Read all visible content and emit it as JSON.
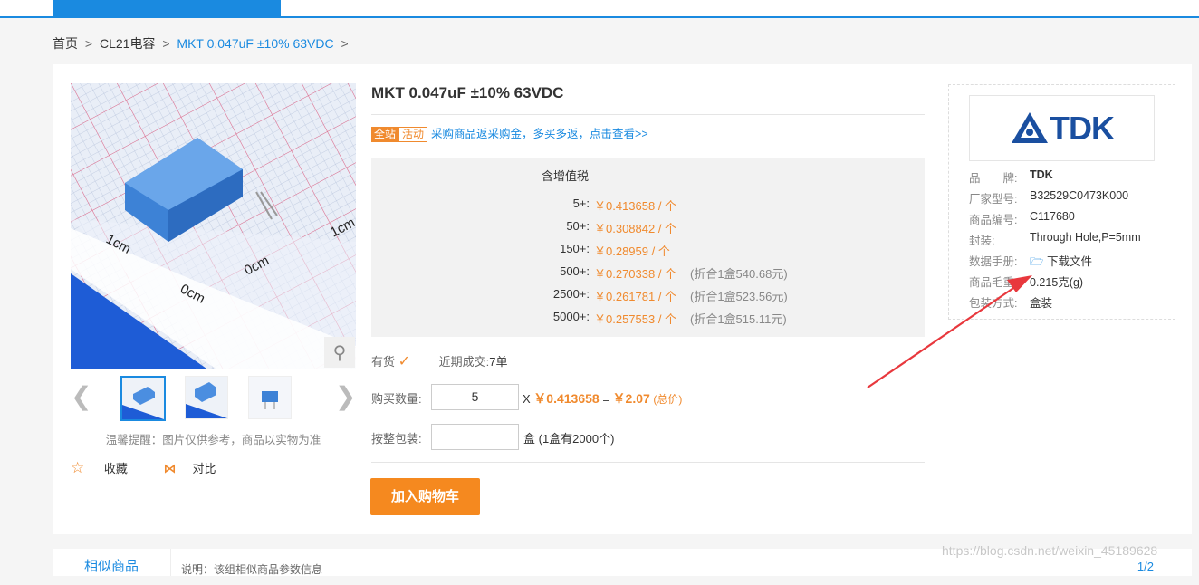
{
  "breadcrumb": {
    "home": "首页",
    "sep1": ">",
    "category": "CL21电容",
    "sep2": ">",
    "product": "MKT 0.047uF ±10% 63VDC",
    "trail": ">"
  },
  "product": {
    "title": "MKT 0.047uF ±10% 63VDC",
    "promo_badge_site": "全站",
    "promo_badge_event": "活动",
    "promo_text": "采购商品返采购金，多买多返，点击查看>>",
    "tax_label": "含增值税",
    "price_tiers": [
      {
        "qty": "5+:",
        "price": "￥0.413658 / 个",
        "box": ""
      },
      {
        "qty": "50+:",
        "price": "￥0.308842 / 个",
        "box": ""
      },
      {
        "qty": "150+:",
        "price": "￥0.28959 / 个",
        "box": ""
      },
      {
        "qty": "500+:",
        "price": "￥0.270338 / 个",
        "box": "(折合1盒540.68元)"
      },
      {
        "qty": "2500+:",
        "price": "￥0.261781 / 个",
        "box": "(折合1盒523.56元)"
      },
      {
        "qty": "5000+:",
        "price": "￥0.257553 / 个",
        "box": "(折合1盒515.11元)"
      }
    ],
    "stock_label": "有货",
    "recent_deals_label": "近期成交:",
    "recent_deals_value": "7单",
    "qty_label": "购买数量:",
    "qty_value": "5",
    "calc_x": "X",
    "unit_price": "￥0.413658",
    "calc_eq": "=",
    "total_price": "￥2.07",
    "total_label": "(总价)",
    "pack_label": "按整包装:",
    "pack_unit": "盒 (1盒有2000个)",
    "add_to_cart": "加入购物车"
  },
  "gallery": {
    "notice": "温馨提醒：图片仅供参考，商品以实物为准",
    "favorite": "收藏",
    "compare": "对比",
    "image_labels": [
      "1cm",
      "0cm",
      "0cm",
      "1cm"
    ]
  },
  "brand": {
    "logo_text": "TDK",
    "attributes": [
      {
        "label": "品　　牌:",
        "value": "TDK"
      },
      {
        "label": "厂家型号:",
        "value": "B32529C0473K000"
      },
      {
        "label": "商品编号:",
        "value": "C117680"
      },
      {
        "label": "封装:",
        "value": "Through Hole,P=5mm"
      },
      {
        "label": "数据手册:",
        "value": "下载文件"
      },
      {
        "label": "商品毛重:",
        "value": "0.215克(g)"
      },
      {
        "label": "包装方式:",
        "value": "盒装"
      }
    ]
  },
  "tabs": {
    "similar": "相似商品",
    "note": "说明：该组相似商品参数信息",
    "pager": "1/2"
  },
  "watermark": "https://blog.csdn.net/weixin_45189628",
  "colors": {
    "accent": "#1a8ae0",
    "price": "#f08a2e",
    "cart": "#f5891f",
    "annotation_arrow": "#e8383d"
  }
}
